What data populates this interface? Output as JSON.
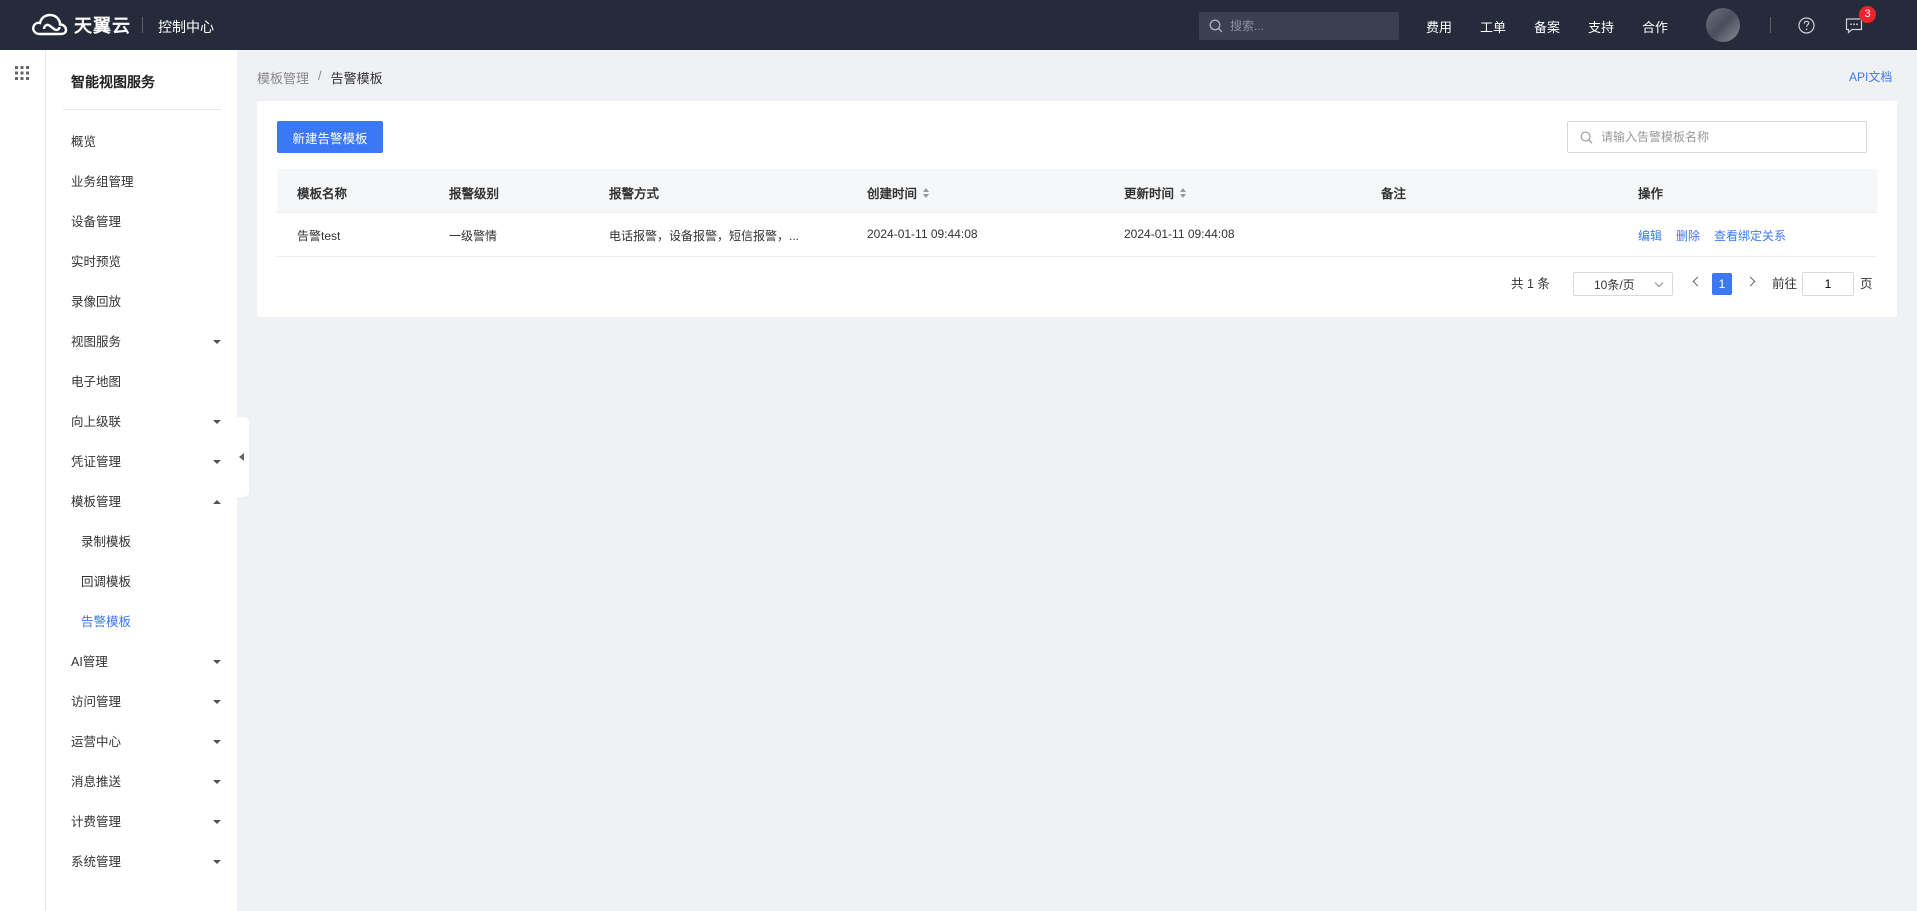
{
  "header": {
    "brand": "天翼云",
    "console_title": "控制中心",
    "search_placeholder": "搜索...",
    "nav": [
      "费用",
      "工单",
      "备案",
      "支持",
      "合作"
    ],
    "notification_count": "3"
  },
  "sidebar": {
    "title": "智能视图服务",
    "items": [
      {
        "label": "概览",
        "caret": "none"
      },
      {
        "label": "业务组管理",
        "caret": "none"
      },
      {
        "label": "设备管理",
        "caret": "none"
      },
      {
        "label": "实时预览",
        "caret": "none"
      },
      {
        "label": "录像回放",
        "caret": "none"
      },
      {
        "label": "视图服务",
        "caret": "down"
      },
      {
        "label": "电子地图",
        "caret": "none"
      },
      {
        "label": "向上级联",
        "caret": "down"
      },
      {
        "label": "凭证管理",
        "caret": "down"
      },
      {
        "label": "模板管理",
        "caret": "up"
      },
      {
        "label": "录制模板",
        "caret": "none",
        "sub": true
      },
      {
        "label": "回调模板",
        "caret": "none",
        "sub": true
      },
      {
        "label": "告警模板",
        "caret": "none",
        "sub": true,
        "active": true
      },
      {
        "label": "AI管理",
        "caret": "down"
      },
      {
        "label": "访问管理",
        "caret": "down"
      },
      {
        "label": "运营中心",
        "caret": "down"
      },
      {
        "label": "消息推送",
        "caret": "down"
      },
      {
        "label": "计费管理",
        "caret": "down"
      },
      {
        "label": "系统管理",
        "caret": "down"
      }
    ]
  },
  "breadcrumb": {
    "parent": "模板管理",
    "separator": "/",
    "current": "告警模板"
  },
  "api_doc_label": "API文档",
  "main": {
    "new_button_label": "新建告警模板",
    "search_placeholder": "请输入告警模板名称",
    "columns": [
      "模板名称",
      "报警级别",
      "报警方式",
      "创建时间",
      "更新时间",
      "备注",
      "操作"
    ],
    "rows": [
      {
        "name": "告警test",
        "level": "一级警情",
        "method": "电话报警，设备报警，短信报警，...",
        "created": "2024-01-11 09:44:08",
        "updated": "2024-01-11 09:44:08",
        "remark": "",
        "actions": [
          "编辑",
          "删除",
          "查看绑定关系"
        ]
      }
    ],
    "pagination": {
      "total_text": "共 1 条",
      "page_size": "10条/页",
      "current_page": "1",
      "goto_prefix": "前往",
      "goto_value": "1",
      "goto_suffix": "页"
    }
  },
  "colors": {
    "accent": "#3c78f6",
    "topbar": "#262b3b",
    "badge": "#e8262a"
  }
}
